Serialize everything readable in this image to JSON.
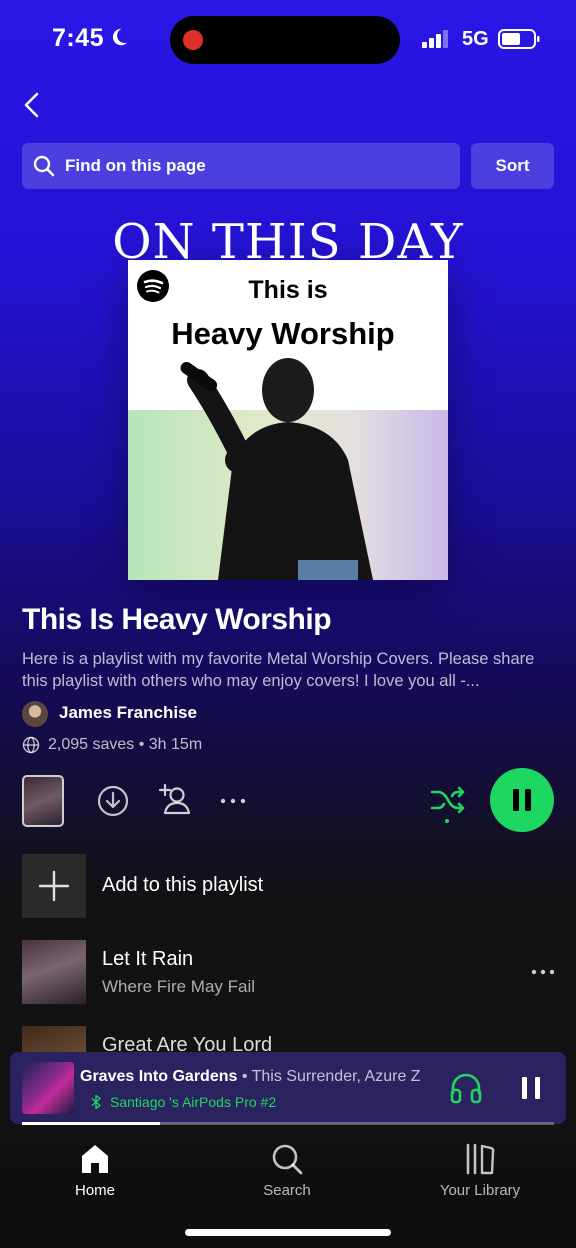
{
  "status_bar": {
    "time": "7:45",
    "network": "5G"
  },
  "search": {
    "placeholder": "Find on this page"
  },
  "sort_label": "Sort",
  "overlay_text": "ON THIS DAY",
  "cover": {
    "line1": "This is",
    "line2": "Heavy Worship"
  },
  "playlist": {
    "title": "This Is Heavy Worship",
    "description": "Here is a playlist with my favorite Metal Worship Covers. Please share this playlist with others who may enjoy covers! I love you all -...",
    "owner": "James Franchise",
    "stats": "2,095 saves • 3h 15m"
  },
  "add_to_playlist_label": "Add to this playlist",
  "tracks": [
    {
      "title": "Let It Rain",
      "artist": "Where Fire May Fail"
    },
    {
      "title": "Great Are You Lord",
      "artist": ""
    }
  ],
  "now_playing": {
    "song": "Graves Into Gardens",
    "artists": " • This Surrender, Azure Z",
    "device": "Santiago 's AirPods Pro #2",
    "progress": 0.26
  },
  "nav": [
    {
      "label": "Home",
      "icon": "home-icon",
      "active": true
    },
    {
      "label": "Search",
      "icon": "search-icon",
      "active": false
    },
    {
      "label": "Your Library",
      "icon": "library-icon",
      "active": false
    }
  ],
  "colors": {
    "accent": "#1ed760",
    "header_top": "#2a16e6",
    "background": "#121212"
  }
}
